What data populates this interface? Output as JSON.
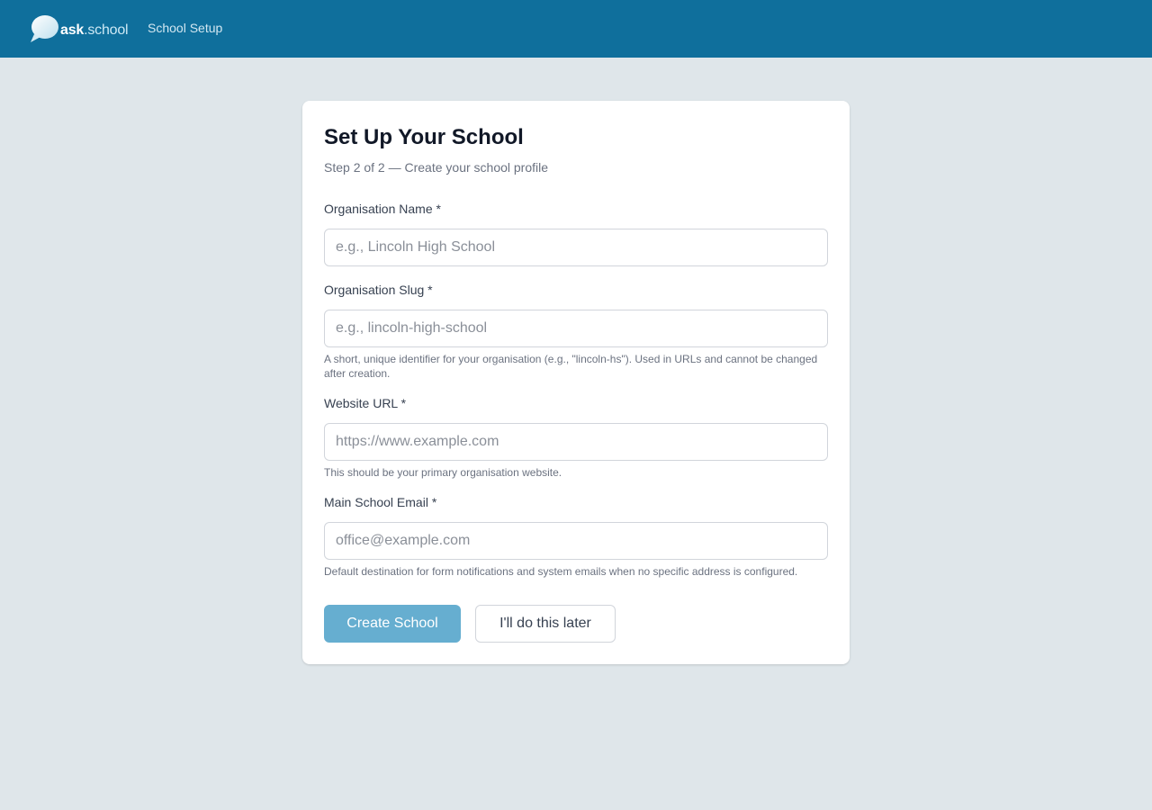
{
  "header": {
    "logo_primary": "ask",
    "logo_secondary": ".school",
    "nav_title": "School Setup",
    "color": "#0f6f9c"
  },
  "form": {
    "title": "Set Up Your School",
    "subtitle": "Step 2 of 2 — Create your school profile",
    "fields": [
      {
        "label": "Organisation Name *",
        "value": "",
        "placeholder": "e.g., Lincoln High School",
        "help": ""
      },
      {
        "label": "Organisation Slug *",
        "value": "",
        "placeholder": "e.g., lincoln-high-school",
        "help": "A short, unique identifier for your organisation (e.g., \"lincoln-hs\"). Used in URLs and cannot be changed after creation."
      },
      {
        "label": "Website URL *",
        "value": "",
        "placeholder": "https://www.example.com",
        "help": "This should be your primary organisation website."
      },
      {
        "label": "Main School Email *",
        "value": "",
        "placeholder": "office@example.com",
        "help": "Default destination for form notifications and system emails when no specific address is configured."
      }
    ],
    "primary_button": "Create School",
    "secondary_button": "I'll do this later",
    "primary_color": "#66aed0"
  },
  "icons": {
    "logo": "speech-bubble-icon"
  }
}
